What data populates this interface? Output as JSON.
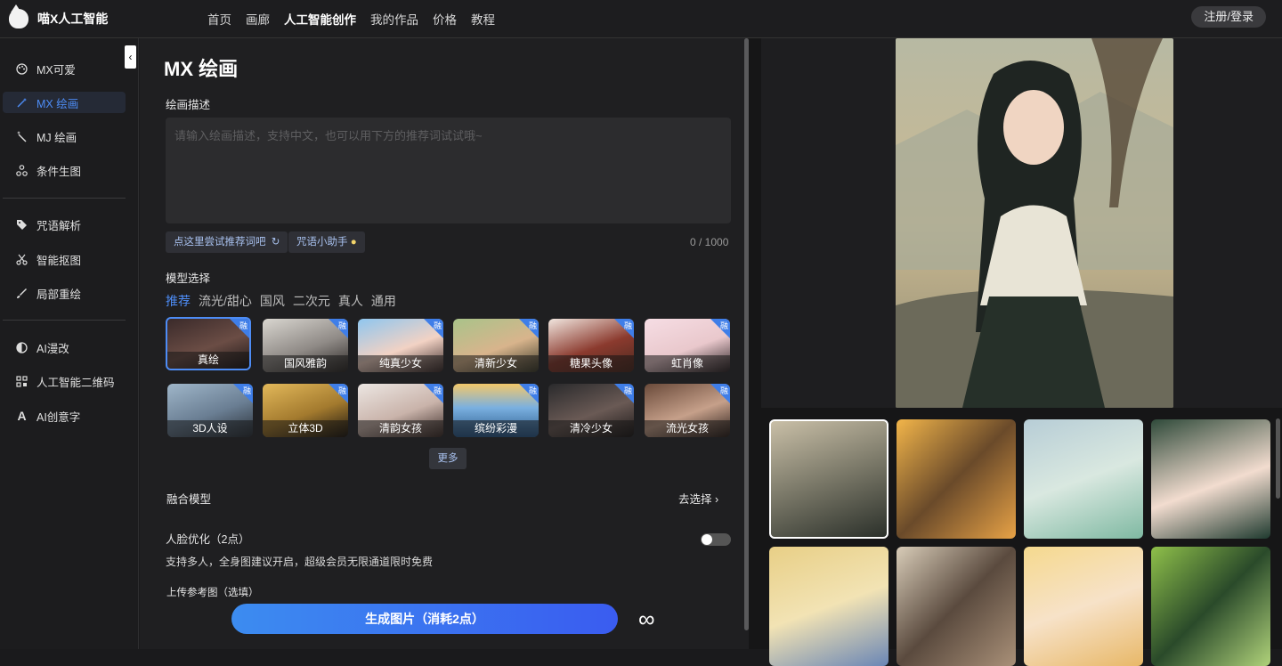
{
  "header": {
    "brand": "喵X人工智能",
    "logo_icon": "cat-logo-icon",
    "nav": [
      "首页",
      "画廊",
      "人工智能创作",
      "我的作品",
      "价格",
      "教程"
    ],
    "nav_active_index": 2,
    "login_label": "注册/登录"
  },
  "sidebar": {
    "items": [
      {
        "label": "MX可爱",
        "icon": "palette-icon"
      },
      {
        "label": "MX 绘画",
        "icon": "magic-wand-icon",
        "active": true
      },
      {
        "label": "MJ 绘画",
        "icon": "sparkle-wand-icon"
      },
      {
        "label": "条件生图",
        "icon": "nodes-icon"
      },
      {
        "label": "咒语解析",
        "icon": "tag-icon"
      },
      {
        "label": "智能抠图",
        "icon": "scissors-icon"
      },
      {
        "label": "局部重绘",
        "icon": "brush-icon"
      },
      {
        "label": "AI漫改",
        "icon": "half-circle-icon"
      },
      {
        "label": "人工智能二维码",
        "icon": "qrcode-icon"
      },
      {
        "label": "AI创意字",
        "icon": "letter-a-icon"
      }
    ]
  },
  "main": {
    "title": "MX 绘画",
    "desc_label": "绘画描述",
    "placeholder": "请输入绘画描述，支持中文，也可以用下方的推荐词试试哦~",
    "chip_try": "点这里尝试推荐词吧",
    "chip_helper": "咒语小助手",
    "char_count": "0 / 1000",
    "model_label": "模型选择",
    "tabs": [
      "推荐",
      "流光/甜心",
      "国风",
      "二次元",
      "真人",
      "通用"
    ],
    "tag": "融",
    "models": [
      {
        "name": "真绘",
        "selected": true
      },
      {
        "name": "国风雅韵"
      },
      {
        "name": "纯真少女"
      },
      {
        "name": "清新少女"
      },
      {
        "name": "糖果头像"
      },
      {
        "name": "虹肖像"
      },
      {
        "name": "3D人设"
      },
      {
        "name": "立体3D"
      },
      {
        "name": "清韵女孩"
      },
      {
        "name": "缤纷彩漫"
      },
      {
        "name": "清冷少女"
      },
      {
        "name": "流光女孩"
      }
    ],
    "more_label": "更多",
    "fusion_label": "融合模型",
    "fusion_select": "去选择",
    "face_label": "人脸优化（2点）",
    "face_on": false,
    "face_note": "支持多人，全身图建议开启，超级会员无限通道限时免费",
    "upload_label": "上传参考图（选填）",
    "generate_label": "生成图片（消耗2点）",
    "infinity_icon": "infinity-icon"
  },
  "colors": {
    "accent": "#4d8cf5",
    "button_start": "#3c8cf0",
    "button_end": "#3a5cf0"
  }
}
